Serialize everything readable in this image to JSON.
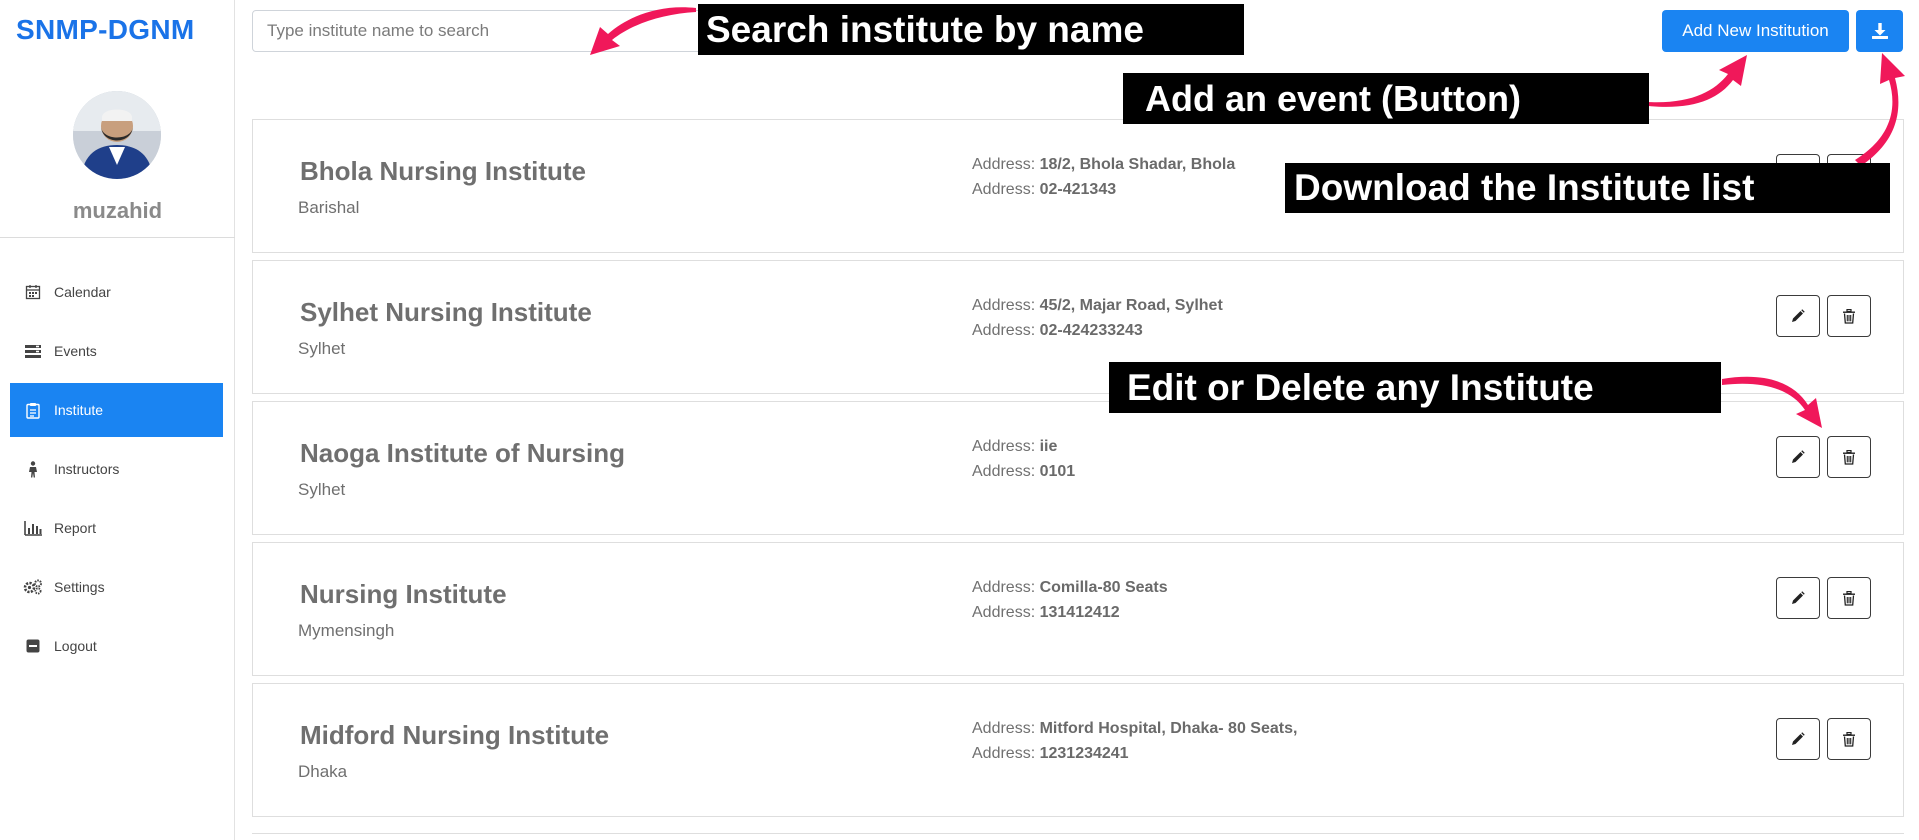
{
  "sidebar": {
    "brand": "SNMP-DGNM",
    "username": "muzahid",
    "items": [
      {
        "label": "Calendar",
        "icon": "calendar-icon",
        "active": false
      },
      {
        "label": "Events",
        "icon": "events-icon",
        "active": false
      },
      {
        "label": "Institute",
        "icon": "clipboard-icon",
        "active": true
      },
      {
        "label": "Instructors",
        "icon": "person-icon",
        "active": false
      },
      {
        "label": "Report",
        "icon": "bar-chart-icon",
        "active": false
      },
      {
        "label": "Settings",
        "icon": "gears-icon",
        "active": false
      },
      {
        "label": "Logout",
        "icon": "minus-square-icon",
        "active": false
      }
    ]
  },
  "toolbar": {
    "search_placeholder": "Type institute name to search",
    "add_label": "Add New Institution",
    "download_icon": "download-icon"
  },
  "institutes": [
    {
      "name": "Bhola Nursing Institute",
      "region": "Barishal",
      "addr_label": "Address:",
      "address": "18/2, Bhola Shadar, Bhola",
      "phone_label": "Address:",
      "phone": "02-421343"
    },
    {
      "name": "Sylhet Nursing Institute",
      "region": "Sylhet",
      "addr_label": "Address:",
      "address": "45/2, Majar Road, Sylhet",
      "phone_label": "Address:",
      "phone": "02-424233243"
    },
    {
      "name": "Naoga Institute of Nursing",
      "region": "Sylhet",
      "addr_label": "Address:",
      "address": "iie",
      "phone_label": "Address:",
      "phone": "0101"
    },
    {
      "name": "Nursing Institute",
      "region": "Mymensingh",
      "addr_label": "Address:",
      "address": "Comilla-80 Seats",
      "phone_label": "Address:",
      "phone": "131412412"
    },
    {
      "name": "Midford Nursing Institute",
      "region": "Dhaka",
      "addr_label": "Address:",
      "address": "Mitford Hospital, Dhaka- 80 Seats,",
      "phone_label": "Address:",
      "phone": "1231234241"
    }
  ],
  "annotations": {
    "search": "Search institute by name",
    "add_event": "Add an event (Button)",
    "download": "Download the Institute list",
    "edit_delete": "Edit or Delete any Institute"
  },
  "colors": {
    "accent": "#1a84f2",
    "brand": "#1a73e8",
    "annotation_arrow": "#f0185a"
  }
}
